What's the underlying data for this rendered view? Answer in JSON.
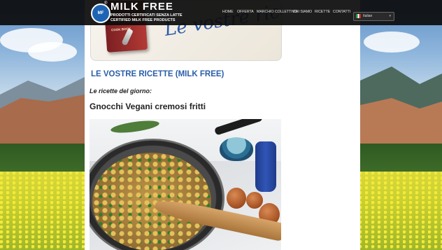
{
  "header": {
    "brand": "MILK FREE",
    "registered_mark": "®",
    "tagline_it": "PRODOTTI CERTIFICATI SENZA LATTE",
    "tagline_en": "CERTIFIED MILK FREE PRODUCTS",
    "nav": [
      {
        "label": "HOME"
      },
      {
        "label": "OFFERTA"
      },
      {
        "label": "MARCHIO COLLETTIVO"
      },
      {
        "label": "CHI SIAMO"
      },
      {
        "label": "RICETTE"
      },
      {
        "label": "CONTATTI"
      }
    ],
    "language": {
      "selected": "Italian"
    }
  },
  "banner": {
    "title": "Le vostre ricette",
    "book_label": "COOK BOOK"
  },
  "main": {
    "page_title": "LE VOSTRE RICETTE (MILK FREE)",
    "subtitle": "Le ricette del giorno:",
    "recipe_title": "Gnocchi Vegani cremosi fritti"
  },
  "colors": {
    "link_blue": "#2a5ea8",
    "topbar": "#0c0c0c",
    "brand_blue": "#1f64b3"
  }
}
